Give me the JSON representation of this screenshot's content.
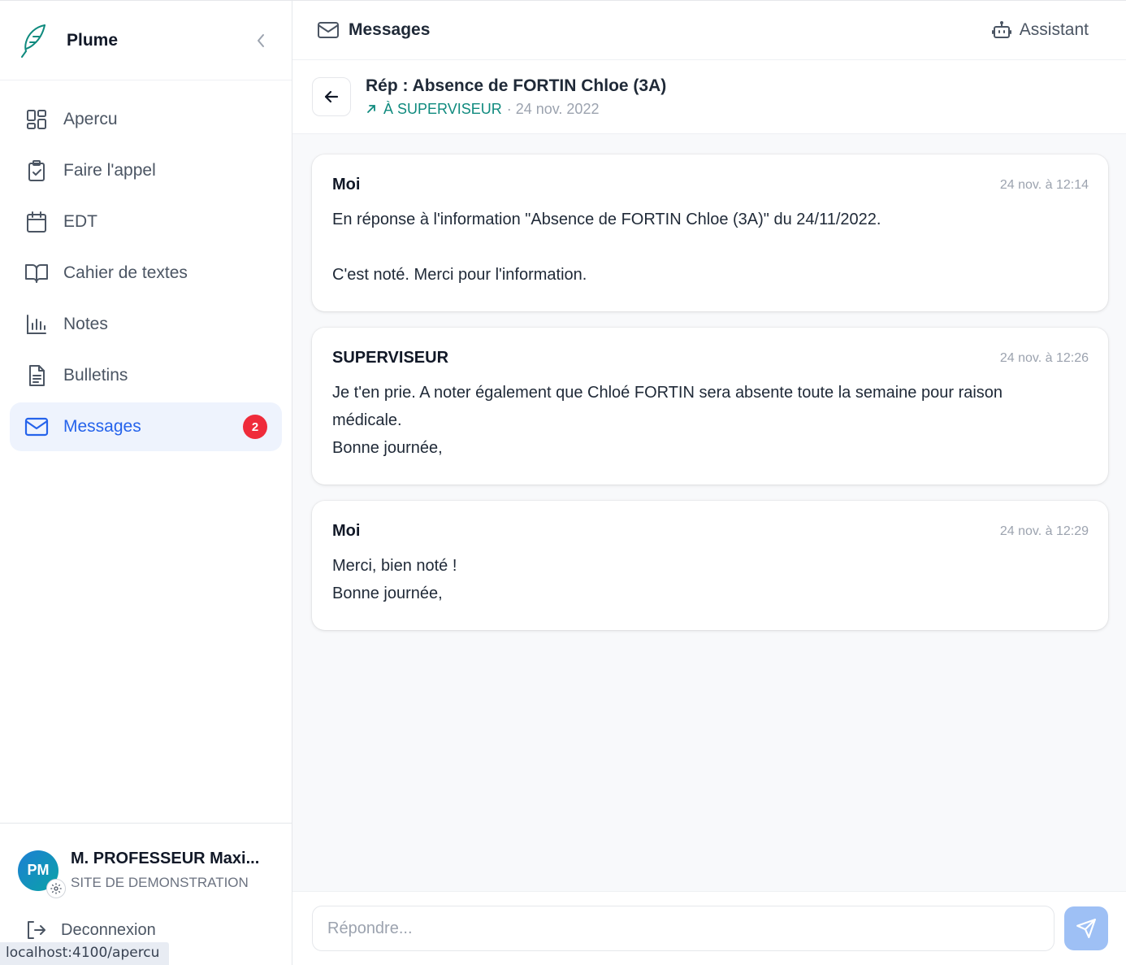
{
  "brand": {
    "name": "Plume",
    "logo_icon": "feather-icon"
  },
  "colors": {
    "accent": "#2563eb",
    "active_bg": "#eef3fd",
    "badge": "#ef2b3a",
    "teal": "#0f8a7e",
    "send_disabled": "#9ec0f5"
  },
  "sidebar": {
    "items": [
      {
        "label": "Apercu",
        "icon": "dashboard-icon",
        "active": false
      },
      {
        "label": "Faire l'appel",
        "icon": "clipboard-check-icon",
        "active": false
      },
      {
        "label": "EDT",
        "icon": "calendar-icon",
        "active": false
      },
      {
        "label": "Cahier de textes",
        "icon": "book-open-icon",
        "active": false
      },
      {
        "label": "Notes",
        "icon": "bar-chart-icon",
        "active": false
      },
      {
        "label": "Bulletins",
        "icon": "file-text-icon",
        "active": false
      },
      {
        "label": "Messages",
        "icon": "mail-icon",
        "active": true,
        "badge": "2"
      }
    ]
  },
  "user": {
    "initials": "PM",
    "name": "M. PROFESSEUR Maxi...",
    "site": "SITE DE DEMONSTRATION"
  },
  "logout_label": "Deconnexion",
  "status_url": "localhost:4100/apercu",
  "header": {
    "title": "Messages",
    "assistant_label": "Assistant"
  },
  "thread": {
    "title": "Rép : Absence de FORTIN Chloe (3A)",
    "recipient": "À SUPERVISEUR",
    "date": "· 24 nov. 2022"
  },
  "messages": [
    {
      "author": "Moi",
      "time": "24 nov. à 12:14",
      "lines": [
        "En réponse à l'information \"Absence de FORTIN Chloe (3A)\" du 24/11/2022.",
        "",
        "C'est noté. Merci pour l'information."
      ]
    },
    {
      "author": "SUPERVISEUR",
      "time": "24 nov. à 12:26",
      "lines": [
        "Je t'en prie. A noter également que Chloé FORTIN sera absente toute la semaine pour raison",
        "médicale.",
        "Bonne journée,"
      ]
    },
    {
      "author": "Moi",
      "time": "24 nov. à 12:29",
      "lines": [
        "Merci, bien noté !",
        "Bonne journée,"
      ]
    }
  ],
  "composer": {
    "placeholder": "Répondre...",
    "value": ""
  }
}
